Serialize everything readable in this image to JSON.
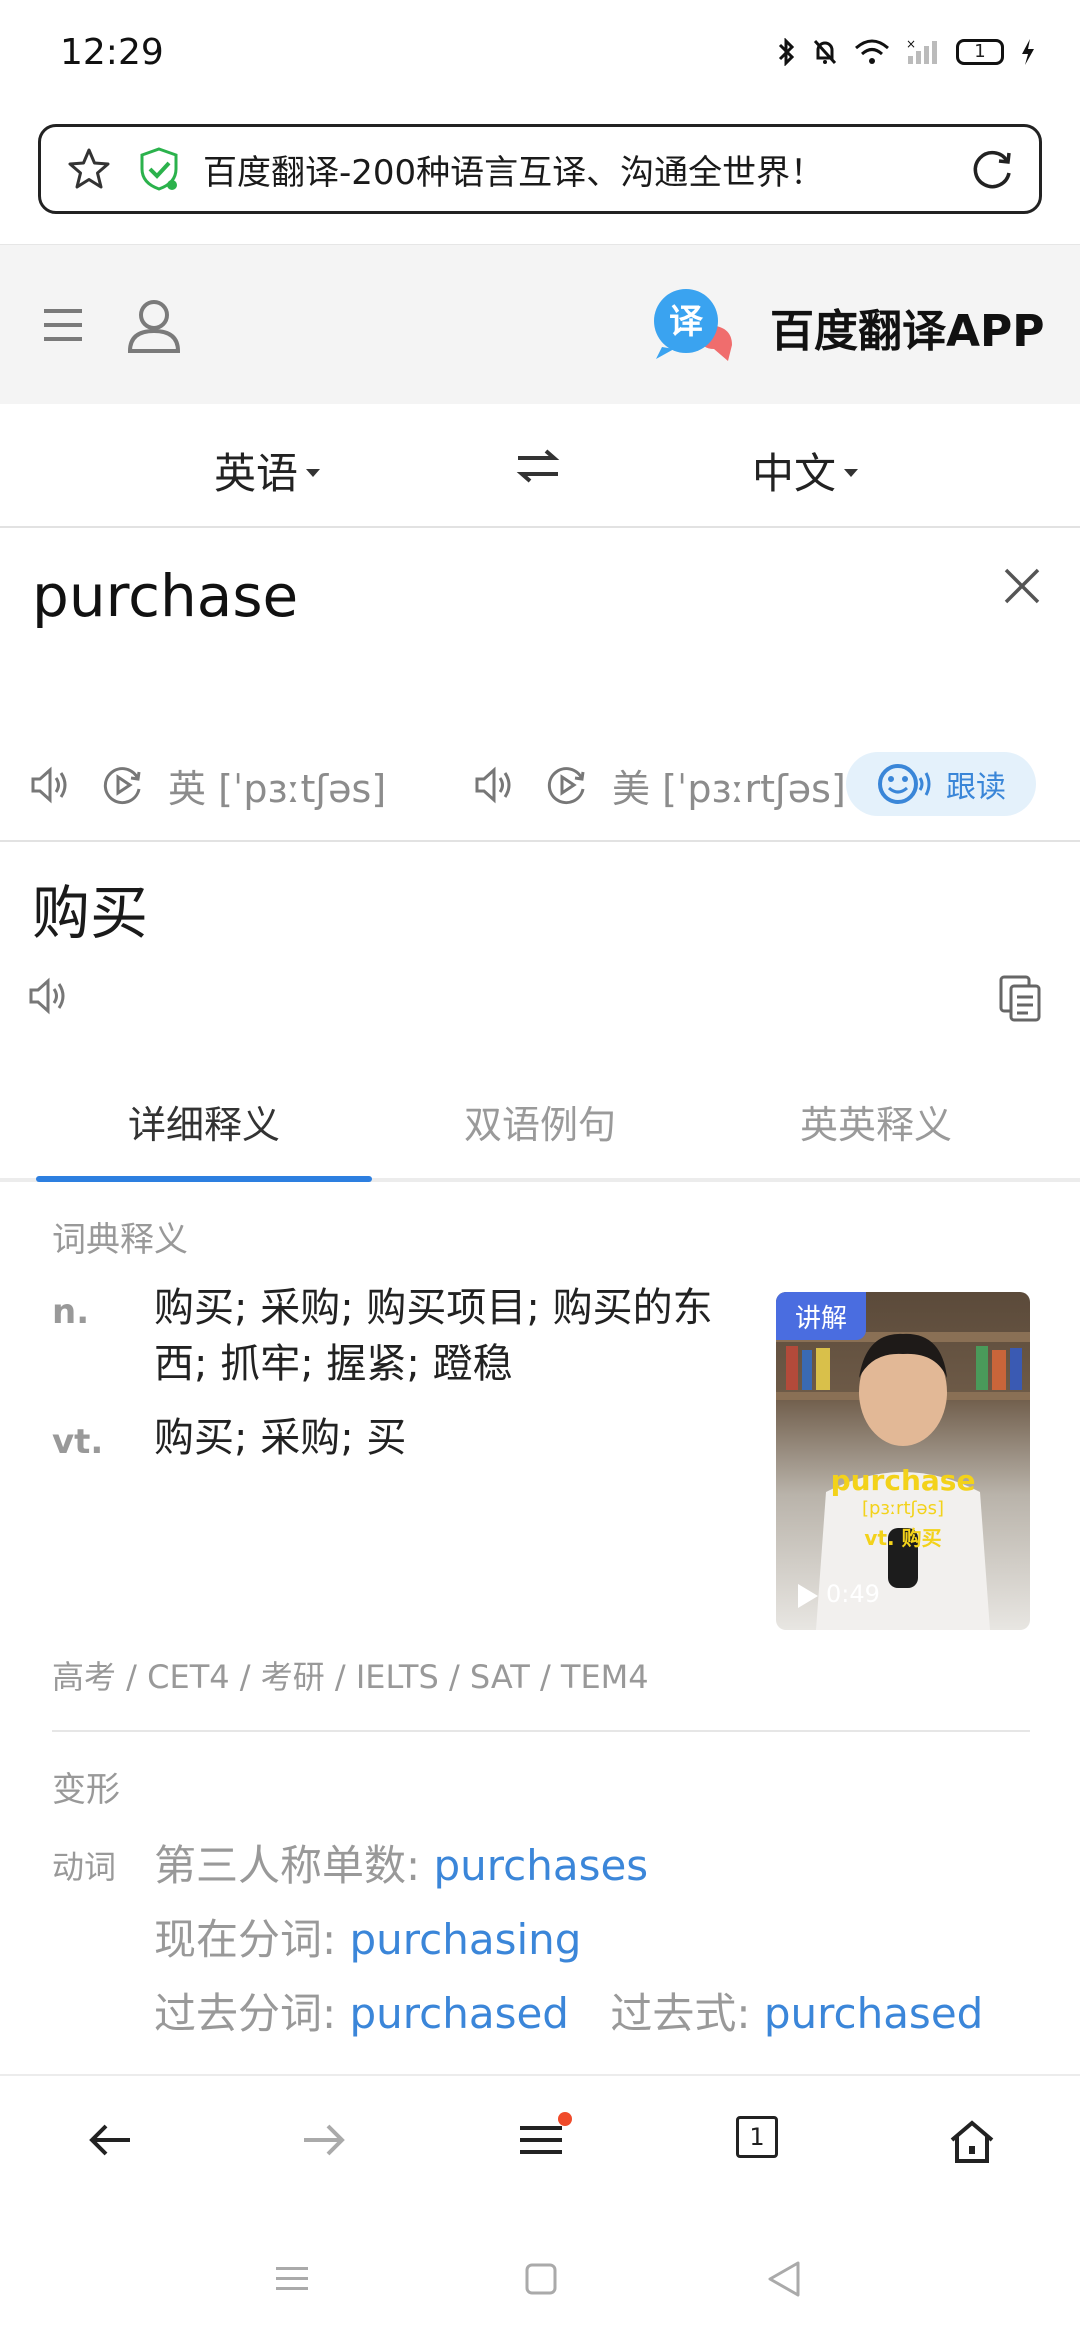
{
  "status_bar": {
    "time": "12:29",
    "battery": "1"
  },
  "url_bar": {
    "title": "百度翻译-200种语言互译、沟通全世界！"
  },
  "header": {
    "app_title": "百度翻译APP",
    "logo_char": "译"
  },
  "languages": {
    "source": "英语",
    "target": "中文"
  },
  "input": {
    "word": "purchase"
  },
  "phonetics": {
    "uk": "英 [ˈpɜːtʃəs]",
    "us": "美 [ˈpɜːrtʃəs]",
    "follow_read_label": "跟读"
  },
  "result": {
    "translation": "购买"
  },
  "tabs": [
    {
      "label": "详细释义",
      "active": true
    },
    {
      "label": "双语例句",
      "active": false
    },
    {
      "label": "英英释义",
      "active": false
    }
  ],
  "dictionary": {
    "section_title": "词典释义",
    "entries": [
      {
        "pos": "n.",
        "definition": "购买; 采购; 购买项目; 购买的东西; 抓牢; 握紧; 蹬稳"
      },
      {
        "pos": "vt.",
        "definition": "购买; 采购; 买"
      }
    ],
    "exams": "高考 / CET4 / 考研 / IELTS / SAT / TEM4",
    "video": {
      "badge": "讲解",
      "word": "purchase",
      "phonetic": "[pɜːrtʃəs]",
      "pos_text": "vt. 购买",
      "duration": "0:49"
    }
  },
  "forms": {
    "section_title": "变形",
    "label": "动词",
    "third_person_label": "第三人称单数:",
    "third_person_value": "purchases",
    "present_participle_label": "现在分词:",
    "present_participle_value": "purchasing",
    "past_participle_label": "过去分词:",
    "past_participle_value": "purchased",
    "past_tense_label": "过去式:",
    "past_tense_value": "purchased"
  },
  "bottom_bar": {
    "tab_count": "1"
  },
  "colors": {
    "accent": "#2d7fe0",
    "link": "#3b86d9",
    "notification_dot": "#f04b2a"
  }
}
